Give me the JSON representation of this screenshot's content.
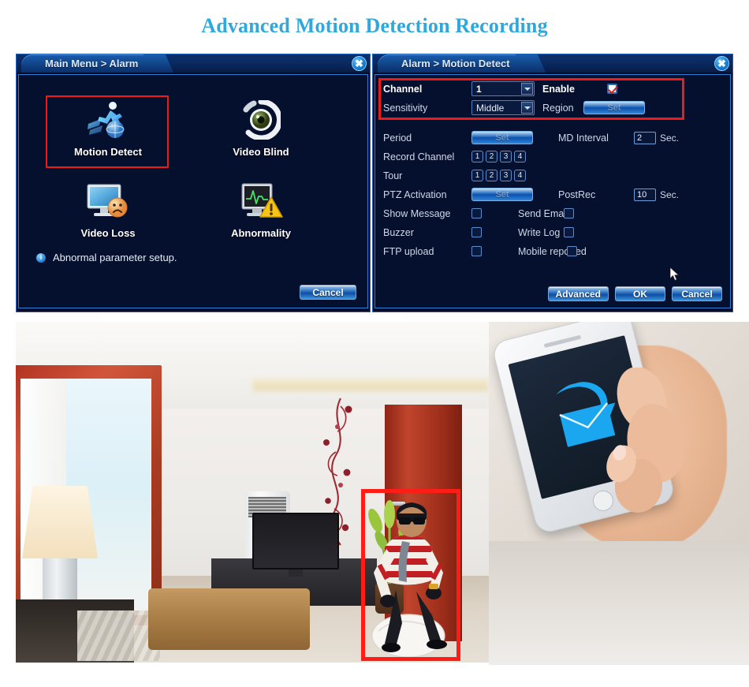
{
  "page": {
    "title": "Advanced Motion Detection Recording"
  },
  "left_panel": {
    "titlebar": {
      "title": "Main Menu > Alarm",
      "close_label": "✖"
    },
    "items": [
      {
        "label": "Motion Detect",
        "icon": "running-man-globe-icon",
        "selected": true
      },
      {
        "label": "Video Blind",
        "icon": "eye-icon",
        "selected": false
      },
      {
        "label": "Video Loss",
        "icon": "monitor-sad-face-icon",
        "selected": false
      },
      {
        "label": "Abnormality",
        "icon": "monitor-warning-icon",
        "selected": false
      }
    ],
    "hint": {
      "icon": "info-icon",
      "text": "Abnormal parameter setup."
    },
    "cancel_label": "Cancel"
  },
  "right_panel": {
    "titlebar": {
      "title": "Alarm > Motion Detect",
      "close_label": "✖"
    },
    "highlight_color": "#ee1b19",
    "fields": {
      "channel_label": "Channel",
      "channel_value": "1",
      "enable_label": "Enable",
      "enable_checked": true,
      "sensitivity_label": "Sensitivity",
      "sensitivity_value": "Middle",
      "region_label": "Region",
      "region_button": "Set",
      "period_label": "Period",
      "period_button": "Set",
      "md_interval_label": "MD Interval",
      "md_interval_value": "2",
      "md_interval_unit": "Sec.",
      "record_channel_label": "Record Channel",
      "record_channels": [
        "1",
        "2",
        "3",
        "4"
      ],
      "tour_label": "Tour",
      "tour_channels": [
        "1",
        "2",
        "3",
        "4"
      ],
      "ptz_activation_label": "PTZ Activation",
      "ptz_button": "Set",
      "postrec_label": "PostRec",
      "postrec_value": "10",
      "postrec_unit": "Sec.",
      "show_message_label": "Show Message",
      "show_message_checked": false,
      "send_email_label": "Send Email",
      "send_email_checked": false,
      "buzzer_label": "Buzzer",
      "buzzer_checked": false,
      "write_log_label": "Write Log",
      "write_log_checked": false,
      "ftp_upload_label": "FTP upload",
      "ftp_upload_checked": false,
      "mobile_reported_label": "Mobile reported",
      "mobile_reported_checked": false
    },
    "buttons": {
      "advanced": "Advanced",
      "ok": "OK",
      "cancel": "Cancel"
    }
  },
  "photos": {
    "room_scene": "living-room-with-intruder",
    "detection_box_color": "#ff1d15",
    "phone_scene": "hand-holding-smartphone-email-alert"
  }
}
